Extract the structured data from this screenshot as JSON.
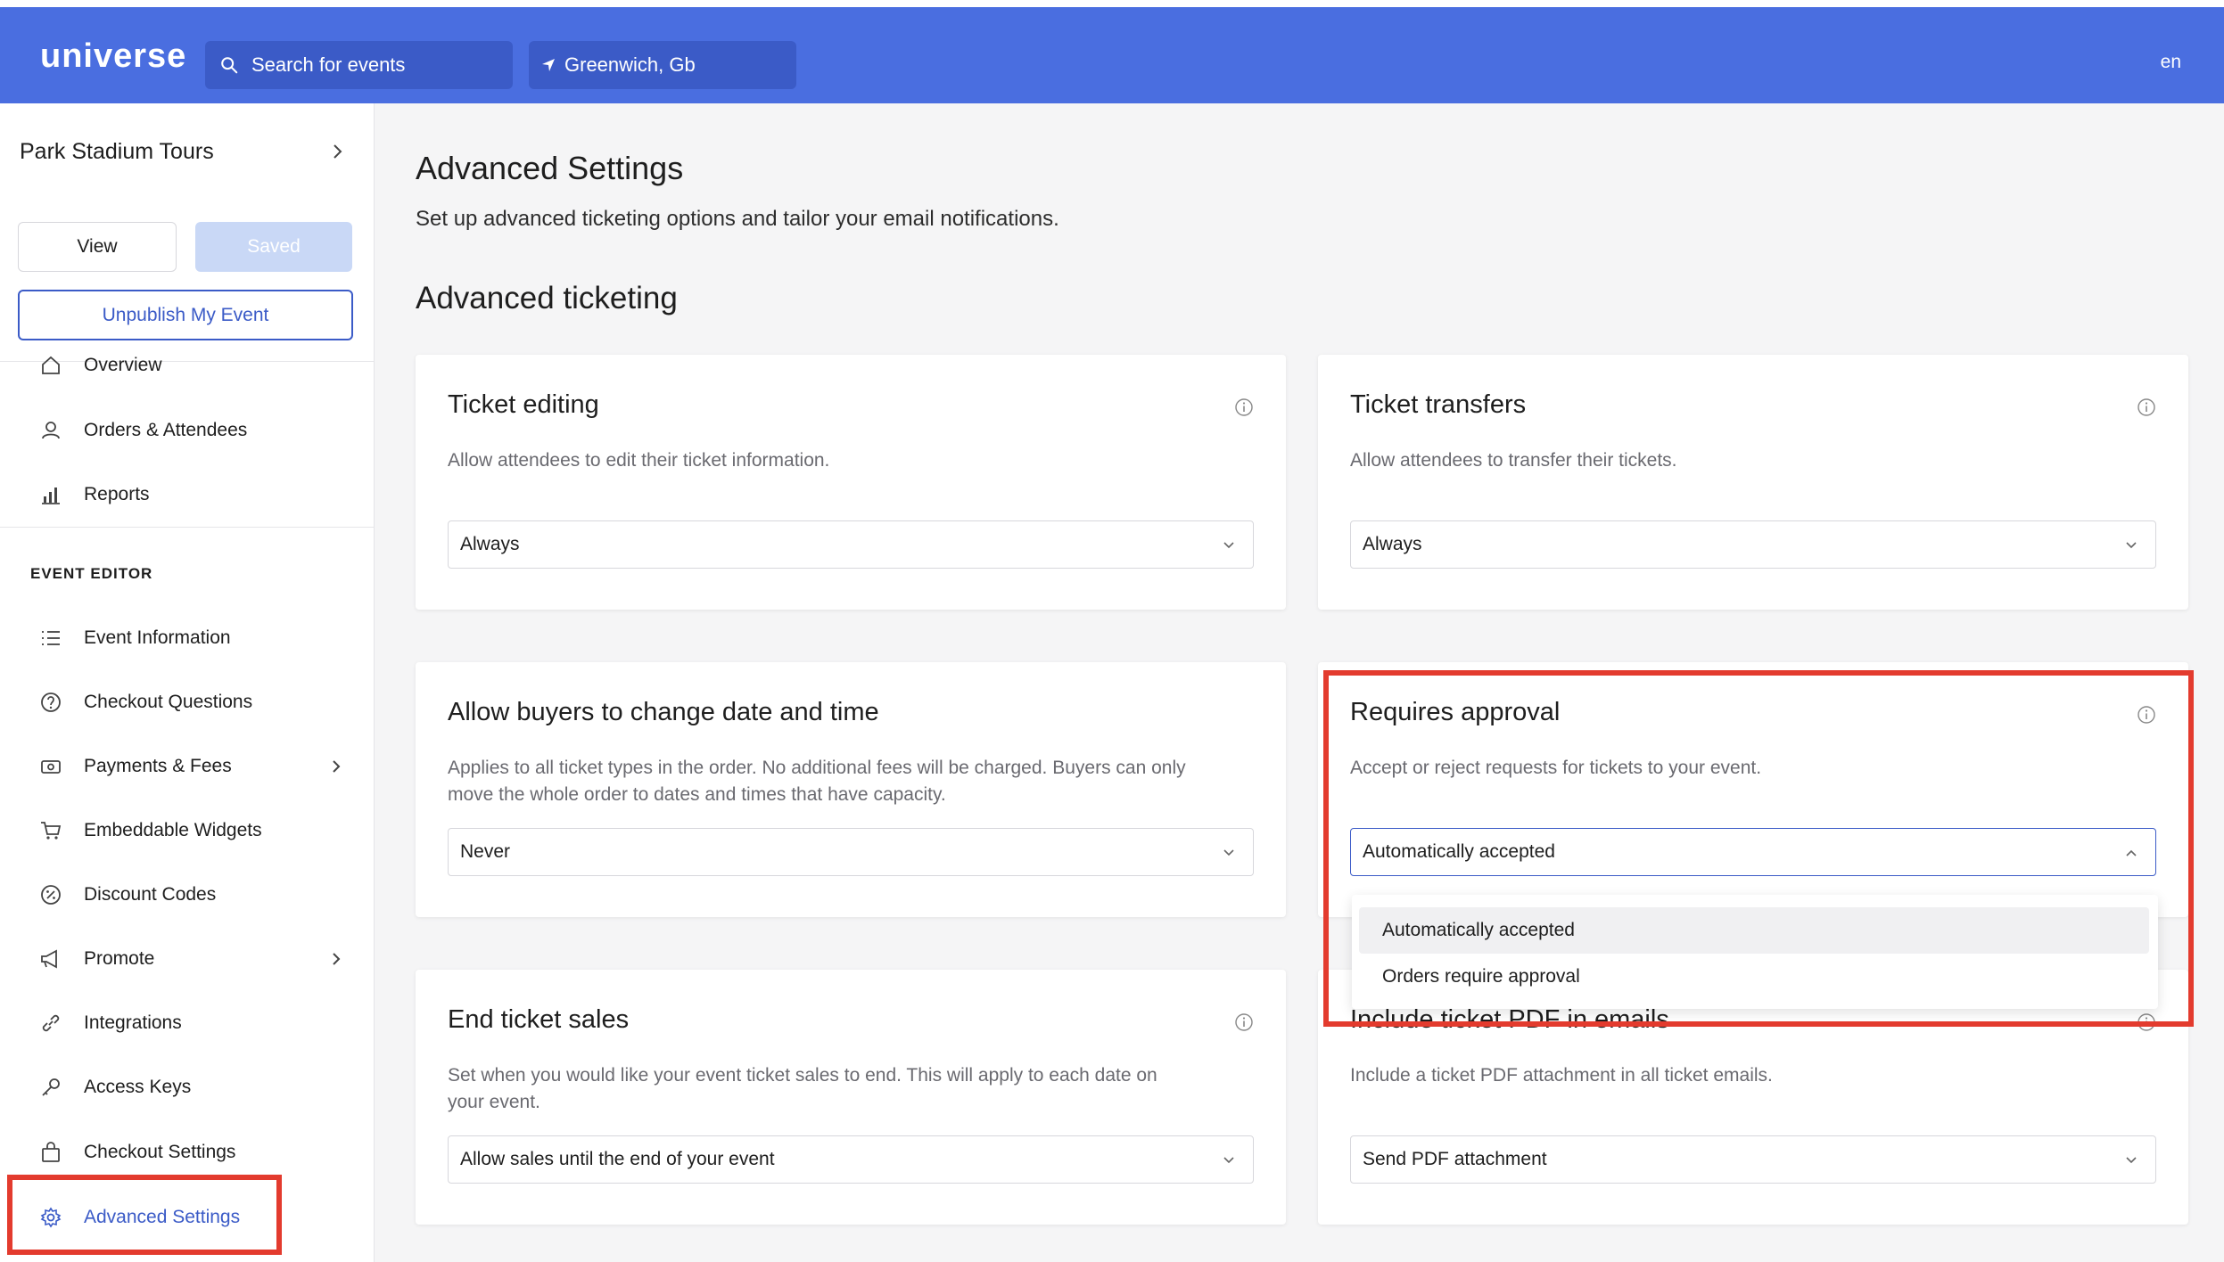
{
  "header": {
    "logo": "universe",
    "search_placeholder": "Search for events",
    "location": "Greenwich, Gb",
    "language": "en"
  },
  "sidebar": {
    "event_name": "Park Stadium Tours",
    "view_label": "View",
    "saved_label": "Saved",
    "unpublish_label": "Unpublish My Event",
    "top_items": [
      {
        "label": "Overview",
        "icon": "home-icon"
      },
      {
        "label": "Orders & Attendees",
        "icon": "users-icon"
      },
      {
        "label": "Reports",
        "icon": "bar-chart-icon"
      }
    ],
    "section_label": "EVENT EDITOR",
    "editor_items": [
      {
        "label": "Event Information",
        "icon": "list-icon"
      },
      {
        "label": "Checkout Questions",
        "icon": "question-icon"
      },
      {
        "label": "Payments & Fees",
        "icon": "cash-icon"
      },
      {
        "label": "Embeddable Widgets",
        "icon": "cart-icon"
      },
      {
        "label": "Discount Codes",
        "icon": "percent-icon"
      },
      {
        "label": "Promote",
        "icon": "megaphone-icon"
      },
      {
        "label": "Integrations",
        "icon": "link-icon"
      },
      {
        "label": "Access Keys",
        "icon": "key-icon"
      },
      {
        "label": "Checkout Settings",
        "icon": "bag-icon"
      },
      {
        "label": "Advanced Settings",
        "icon": "gear-icon"
      }
    ]
  },
  "main": {
    "title": "Advanced Settings",
    "subtitle": "Set up advanced ticketing options and tailor your email notifications.",
    "section_title": "Advanced ticketing",
    "cards": {
      "ticket_editing": {
        "title": "Ticket editing",
        "description": "Allow attendees to edit their ticket information.",
        "value": "Always"
      },
      "ticket_transfers": {
        "title": "Ticket transfers",
        "description": "Allow attendees to transfer their tickets.",
        "value": "Always"
      },
      "change_date": {
        "title": "Allow buyers to change date and time",
        "description_line1": "Applies to all ticket types in the order. No additional fees will be charged. Buyers can only",
        "description_line2": "move the whole order to dates and times that have capacity.",
        "value": "Never"
      },
      "requires_approval": {
        "title": "Requires approval",
        "description": "Accept or reject requests for tickets to your event.",
        "value": "Automatically accepted",
        "options": [
          "Automatically accepted",
          "Orders require approval"
        ]
      },
      "end_sales": {
        "title": "End ticket sales",
        "description_line1": "Set when you would like your event ticket sales to end. This will apply to each date on",
        "description_line2": "your event.",
        "value": "Allow sales until the end of your event"
      },
      "ticket_pdf": {
        "title": "Include ticket PDF in emails",
        "description": "Include a ticket PDF attachment in all ticket emails.",
        "value": "Send PDF attachment"
      }
    }
  },
  "colors": {
    "header_bg": "#4a6ee0",
    "accent": "#3b5bc7",
    "highlight_box": "#e33b2e"
  }
}
